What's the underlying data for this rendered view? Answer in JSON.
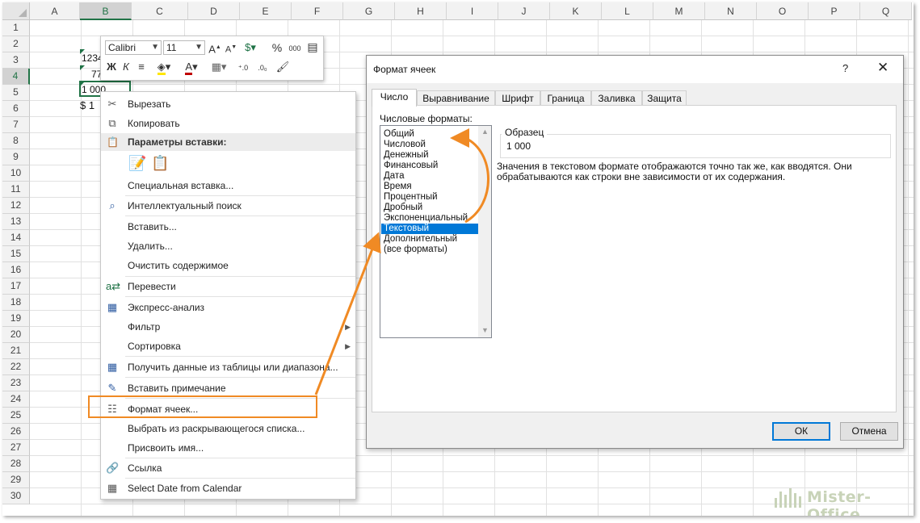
{
  "columns": [
    "A",
    "B",
    "C",
    "D",
    "E",
    "F",
    "G",
    "H",
    "I",
    "J",
    "K",
    "L",
    "M",
    "N",
    "O",
    "P",
    "Q"
  ],
  "rows": [
    "1",
    "2",
    "3",
    "4",
    "5",
    "6",
    "7",
    "8",
    "9",
    "10",
    "11",
    "12",
    "13",
    "14",
    "15",
    "16",
    "17",
    "18",
    "19",
    "20",
    "21",
    "22",
    "23",
    "24",
    "25",
    "26",
    "27",
    "28",
    "29",
    "30"
  ],
  "cells": {
    "b2": "1234",
    "b3": "77",
    "b4": "1 000",
    "b5": "$  1"
  },
  "mini_toolbar": {
    "font_name": "Calibri",
    "font_size": "11",
    "bold": "Ж",
    "italic": "К",
    "percent": "%",
    "thousands": "000"
  },
  "context_menu": {
    "cut": "Вырезать",
    "copy": "Копировать",
    "paste_options": "Параметры вставки:",
    "paste_special": "Специальная вставка...",
    "smart_lookup": "Интеллектуальный поиск",
    "insert": "Вставить...",
    "delete": "Удалить...",
    "clear": "Очистить содержимое",
    "translate": "Перевести",
    "quick_analysis": "Экспресс-анализ",
    "filter": "Фильтр",
    "sort": "Сортировка",
    "get_data": "Получить данные из таблицы или диапазона...",
    "insert_comment": "Вставить примечание",
    "format_cells": "Формат ячеек...",
    "pick_list": "Выбрать из раскрывающегося списка...",
    "define_name": "Присвоить имя...",
    "link": "Ссылка",
    "select_date": "Select Date from Calendar"
  },
  "dialog": {
    "title": "Формат ячеек",
    "help": "?",
    "close": "✕",
    "tabs": [
      "Число",
      "Выравнивание",
      "Шрифт",
      "Граница",
      "Заливка",
      "Защита"
    ],
    "formats_label": "Числовые форматы:",
    "formats": [
      "Общий",
      "Числовой",
      "Денежный",
      "Финансовый",
      "Дата",
      "Время",
      "Процентный",
      "Дробный",
      "Экспоненциальный",
      "Текстовый",
      "Дополнительный",
      "(все форматы)"
    ],
    "selected_format": "Текстовый",
    "sample_label": "Образец",
    "sample_value": "1 000",
    "description": "Значения в текстовом формате отображаются точно так же, как вводятся. Они обрабатываются как строки вне зависимости от их содержания.",
    "ok": "ОК",
    "cancel": "Отмена"
  },
  "watermark": "Mister-Office",
  "colors": {
    "accent": "#217346",
    "highlight": "#0078d7",
    "annotation": "#f08a24"
  }
}
